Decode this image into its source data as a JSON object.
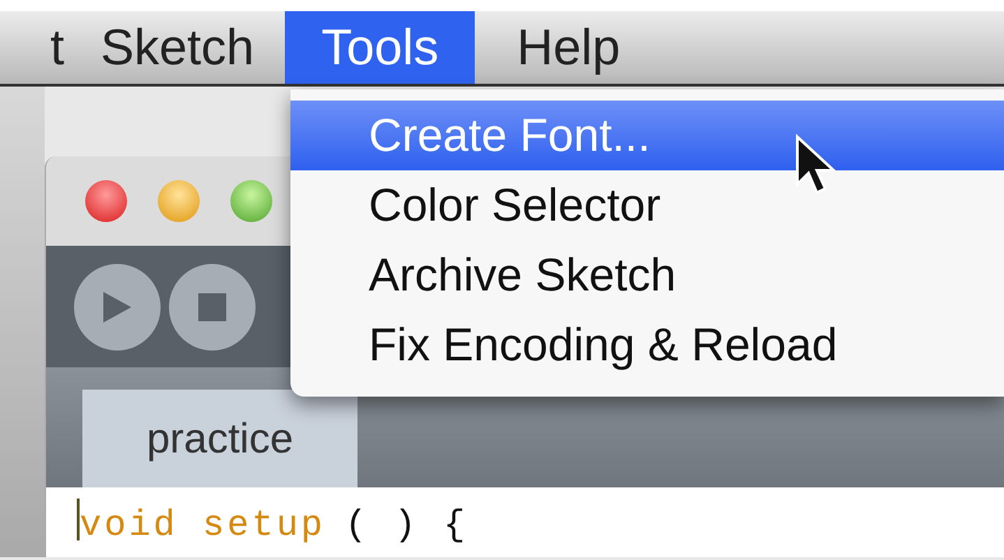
{
  "menu_bar": {
    "items": [
      {
        "label": "t",
        "selected": false
      },
      {
        "label": "Sketch",
        "selected": false
      },
      {
        "label": "Tools",
        "selected": true
      },
      {
        "label": "Help",
        "selected": false
      }
    ]
  },
  "menu": {
    "items": [
      {
        "label": "Create Font...",
        "selected": true
      },
      {
        "label": "Color Selector",
        "selected": false
      },
      {
        "label": "Archive Sketch",
        "selected": false
      },
      {
        "label": "Fix Encoding & Reload",
        "selected": false
      }
    ]
  },
  "editor": {
    "tabs": [
      {
        "label": "practice",
        "selected": true
      }
    ],
    "code_line": [
      {
        "text": "void setup",
        "kind": "keyword"
      },
      {
        "text": "( ) {",
        "kind": "plain"
      }
    ]
  }
}
